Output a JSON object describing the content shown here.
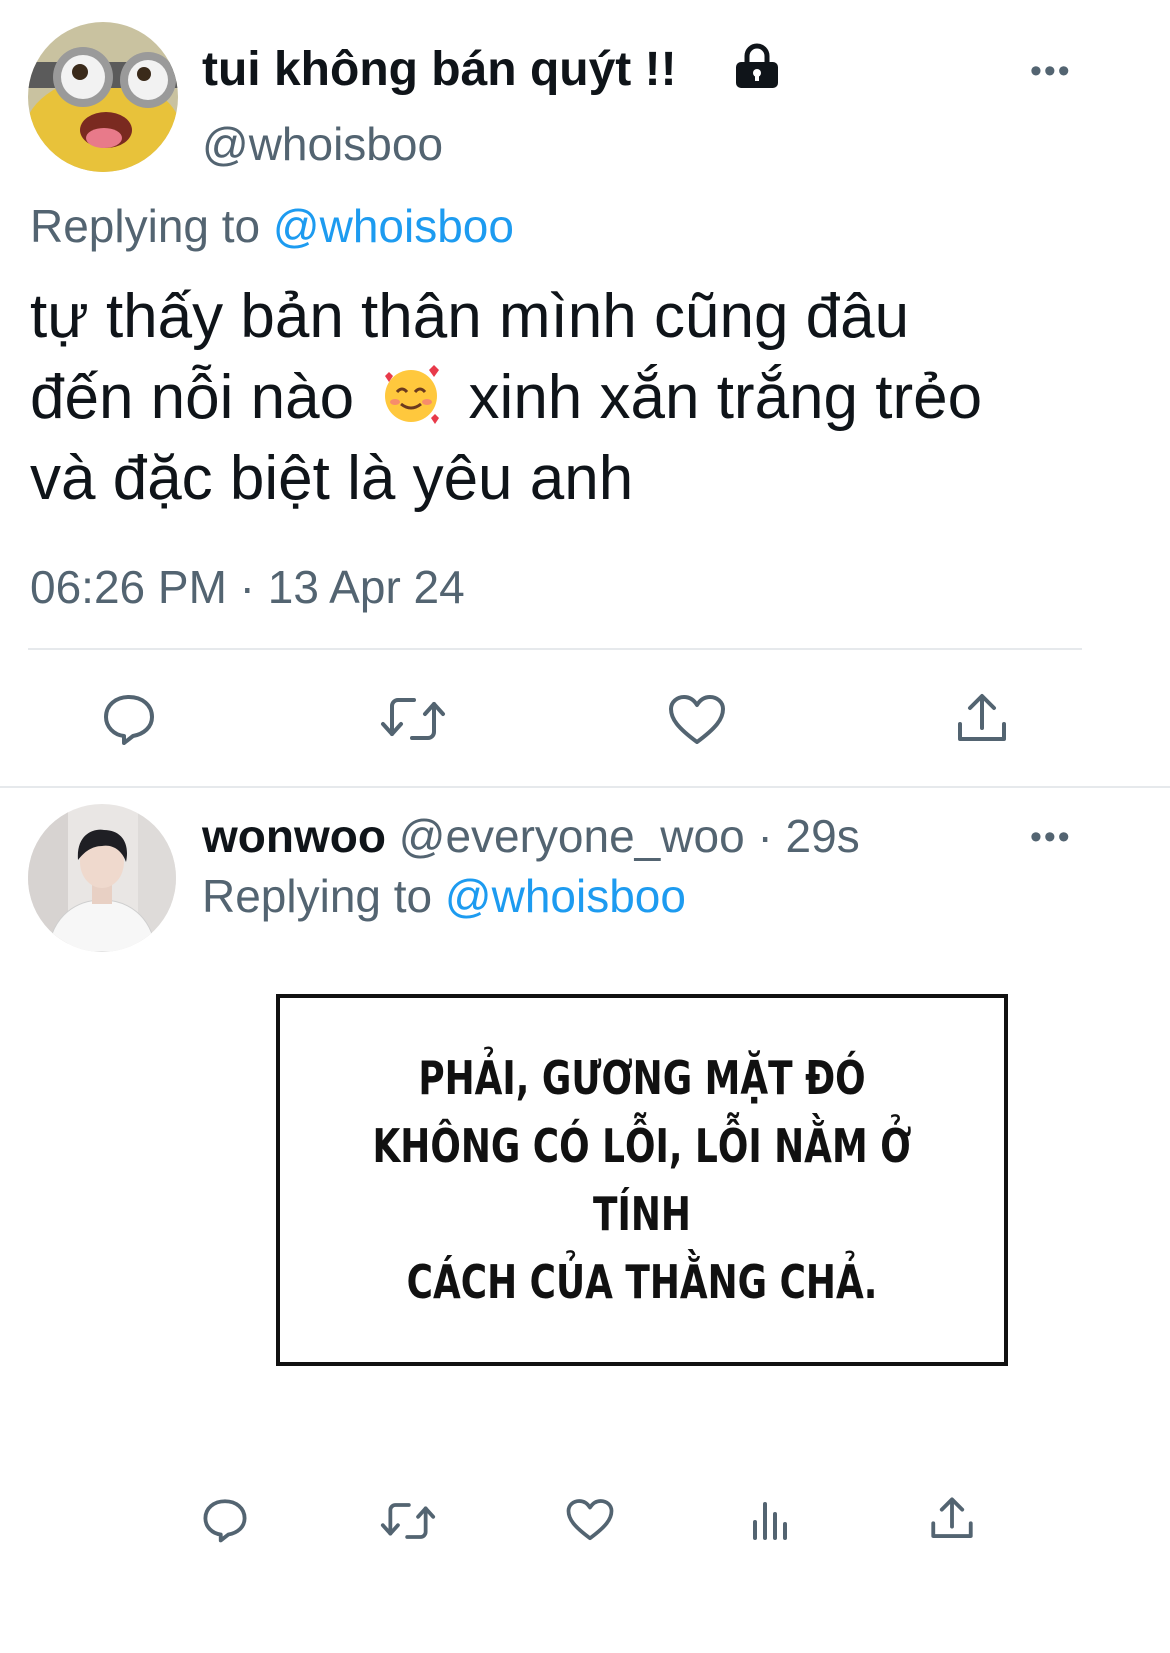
{
  "main_tweet": {
    "display_name": "tui không bán quýt !!",
    "handle": "@whoisboo",
    "replying_label": "Replying to",
    "replying_handle": "@whoisboo",
    "text_line1": "tự thấy bản thân mình cũng đâu",
    "text_line2_a": "đến nỗi nào",
    "text_line2_b": "xinh xắn trắng trẻo",
    "text_line3": "và đặc biệt là yêu anh",
    "timestamp": "06:26 PM · 13 Apr 24",
    "more_label": "•••",
    "icons": [
      "lock-icon",
      "reply-icon",
      "retweet-icon",
      "like-icon",
      "share-icon",
      "smiling-face-with-hearts-emoji"
    ]
  },
  "reply_tweet": {
    "display_name": "wonwoo",
    "handle": "@everyone_woo",
    "separator": "·",
    "time": "29s",
    "replying_label": "Replying to",
    "replying_handle": "@whoisboo",
    "more_label": "•••",
    "image_text_line1": "PHẢI, GƯƠNG MẶT ĐÓ",
    "image_text_line2": "KHÔNG CÓ LỖI, LỖI NẰM Ở TÍNH",
    "image_text_line3": "CÁCH CỦA THẰNG CHẢ.",
    "icons": [
      "reply-icon",
      "retweet-icon",
      "like-icon",
      "analytics-icon",
      "share-icon"
    ]
  },
  "colors": {
    "link": "#1d9bf0",
    "secondary": "#536471",
    "divider": "#e6e9ec"
  }
}
